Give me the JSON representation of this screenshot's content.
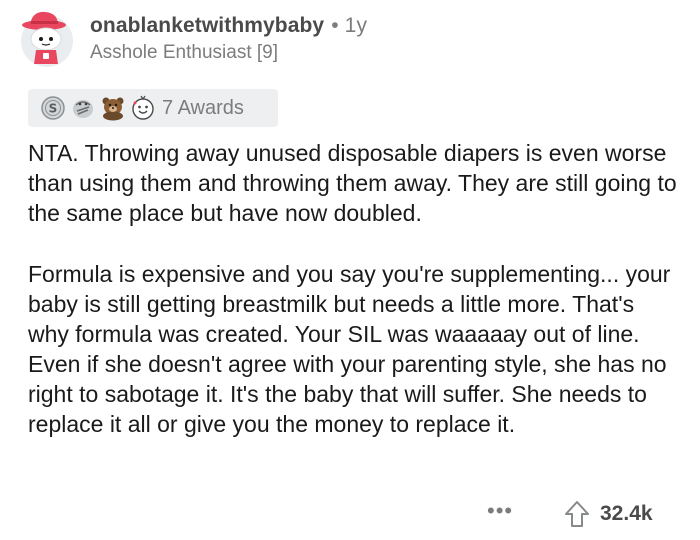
{
  "comment": {
    "username": "onablanketwithmybaby",
    "separator": "•",
    "age": "1y",
    "flair": "Asshole Enthusiast [9]",
    "awards": {
      "icons": [
        "silver-coin-icon",
        "hugz-icon",
        "bear-award-icon",
        "wholesome-award-icon"
      ],
      "label": "7 Awards"
    },
    "paragraphs": [
      "NTA. Throwing away unused disposable diapers is even worse than using them and throwing them away. They are still going to the same place but have now doubled.",
      "Formula is expensive and you say you're supplementing... your baby is still getting breastmilk but needs a little more. That's why formula was created. Your SIL was waaaaay out of line. Even if she doesn't agree with your parenting style, she has no right to sabotage it. It's the baby that will suffer. She needs to replace it all or give you the money to replace it."
    ],
    "footer": {
      "more_label": "•••",
      "score": "32.4k"
    }
  }
}
